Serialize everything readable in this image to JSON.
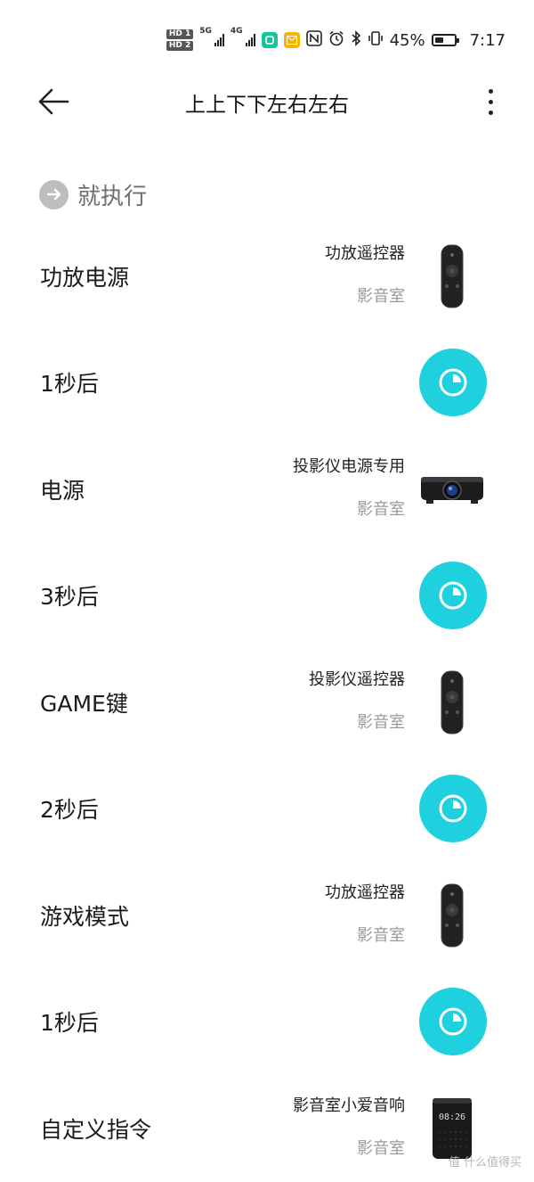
{
  "status_bar": {
    "hd1": "HD 1",
    "hd2": "HD 2",
    "net1": "5G",
    "net2": "4G",
    "battery_percent": "45%",
    "battery_level": 0.45,
    "time": "7:17"
  },
  "header": {
    "title": "上上下下左右左右"
  },
  "section": {
    "title": "就执行"
  },
  "steps": [
    {
      "label": "功放电源",
      "device": "功放遥控器",
      "room": "影音室",
      "icon": "remote-icon"
    },
    {
      "label": "1秒后",
      "icon": "timer-icon"
    },
    {
      "label": "电源",
      "device": "投影仪电源专用",
      "room": "影音室",
      "icon": "projector-icon"
    },
    {
      "label": "3秒后",
      "icon": "timer-icon"
    },
    {
      "label": "GAME键",
      "device": "投影仪遥控器",
      "room": "影音室",
      "icon": "remote-icon"
    },
    {
      "label": "2秒后",
      "icon": "timer-icon"
    },
    {
      "label": "游戏模式",
      "device": "功放遥控器",
      "room": "影音室",
      "icon": "remote-icon"
    },
    {
      "label": "1秒后",
      "icon": "timer-icon"
    },
    {
      "label": "自定义指令",
      "device": "影音室小爱音响",
      "room": "影音室",
      "icon": "smart-speaker-icon",
      "speaker_display": "08:26"
    }
  ],
  "watermark": "值 什么值得买",
  "colors": {
    "timer_bg": "#1fd1de",
    "section_icon": "#bdbdbd",
    "secondary_text": "#9a9a9a"
  }
}
